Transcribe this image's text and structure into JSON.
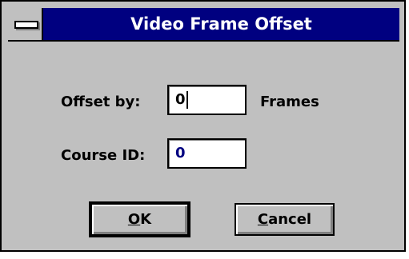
{
  "window": {
    "title": "Video Frame Offset",
    "system_menu_icon": "system-menu-bar-icon"
  },
  "form": {
    "offset_label": "Offset by:",
    "offset_value": "0",
    "offset_unit": "Frames",
    "course_label": "Course ID:",
    "course_value": "0"
  },
  "buttons": {
    "ok_mnemonic": "O",
    "ok_rest": "K",
    "cancel_mnemonic": "C",
    "cancel_rest": "ancel"
  },
  "colors": {
    "titlebar": "#000080",
    "face": "#c0c0c0",
    "course_text": "#000080"
  }
}
